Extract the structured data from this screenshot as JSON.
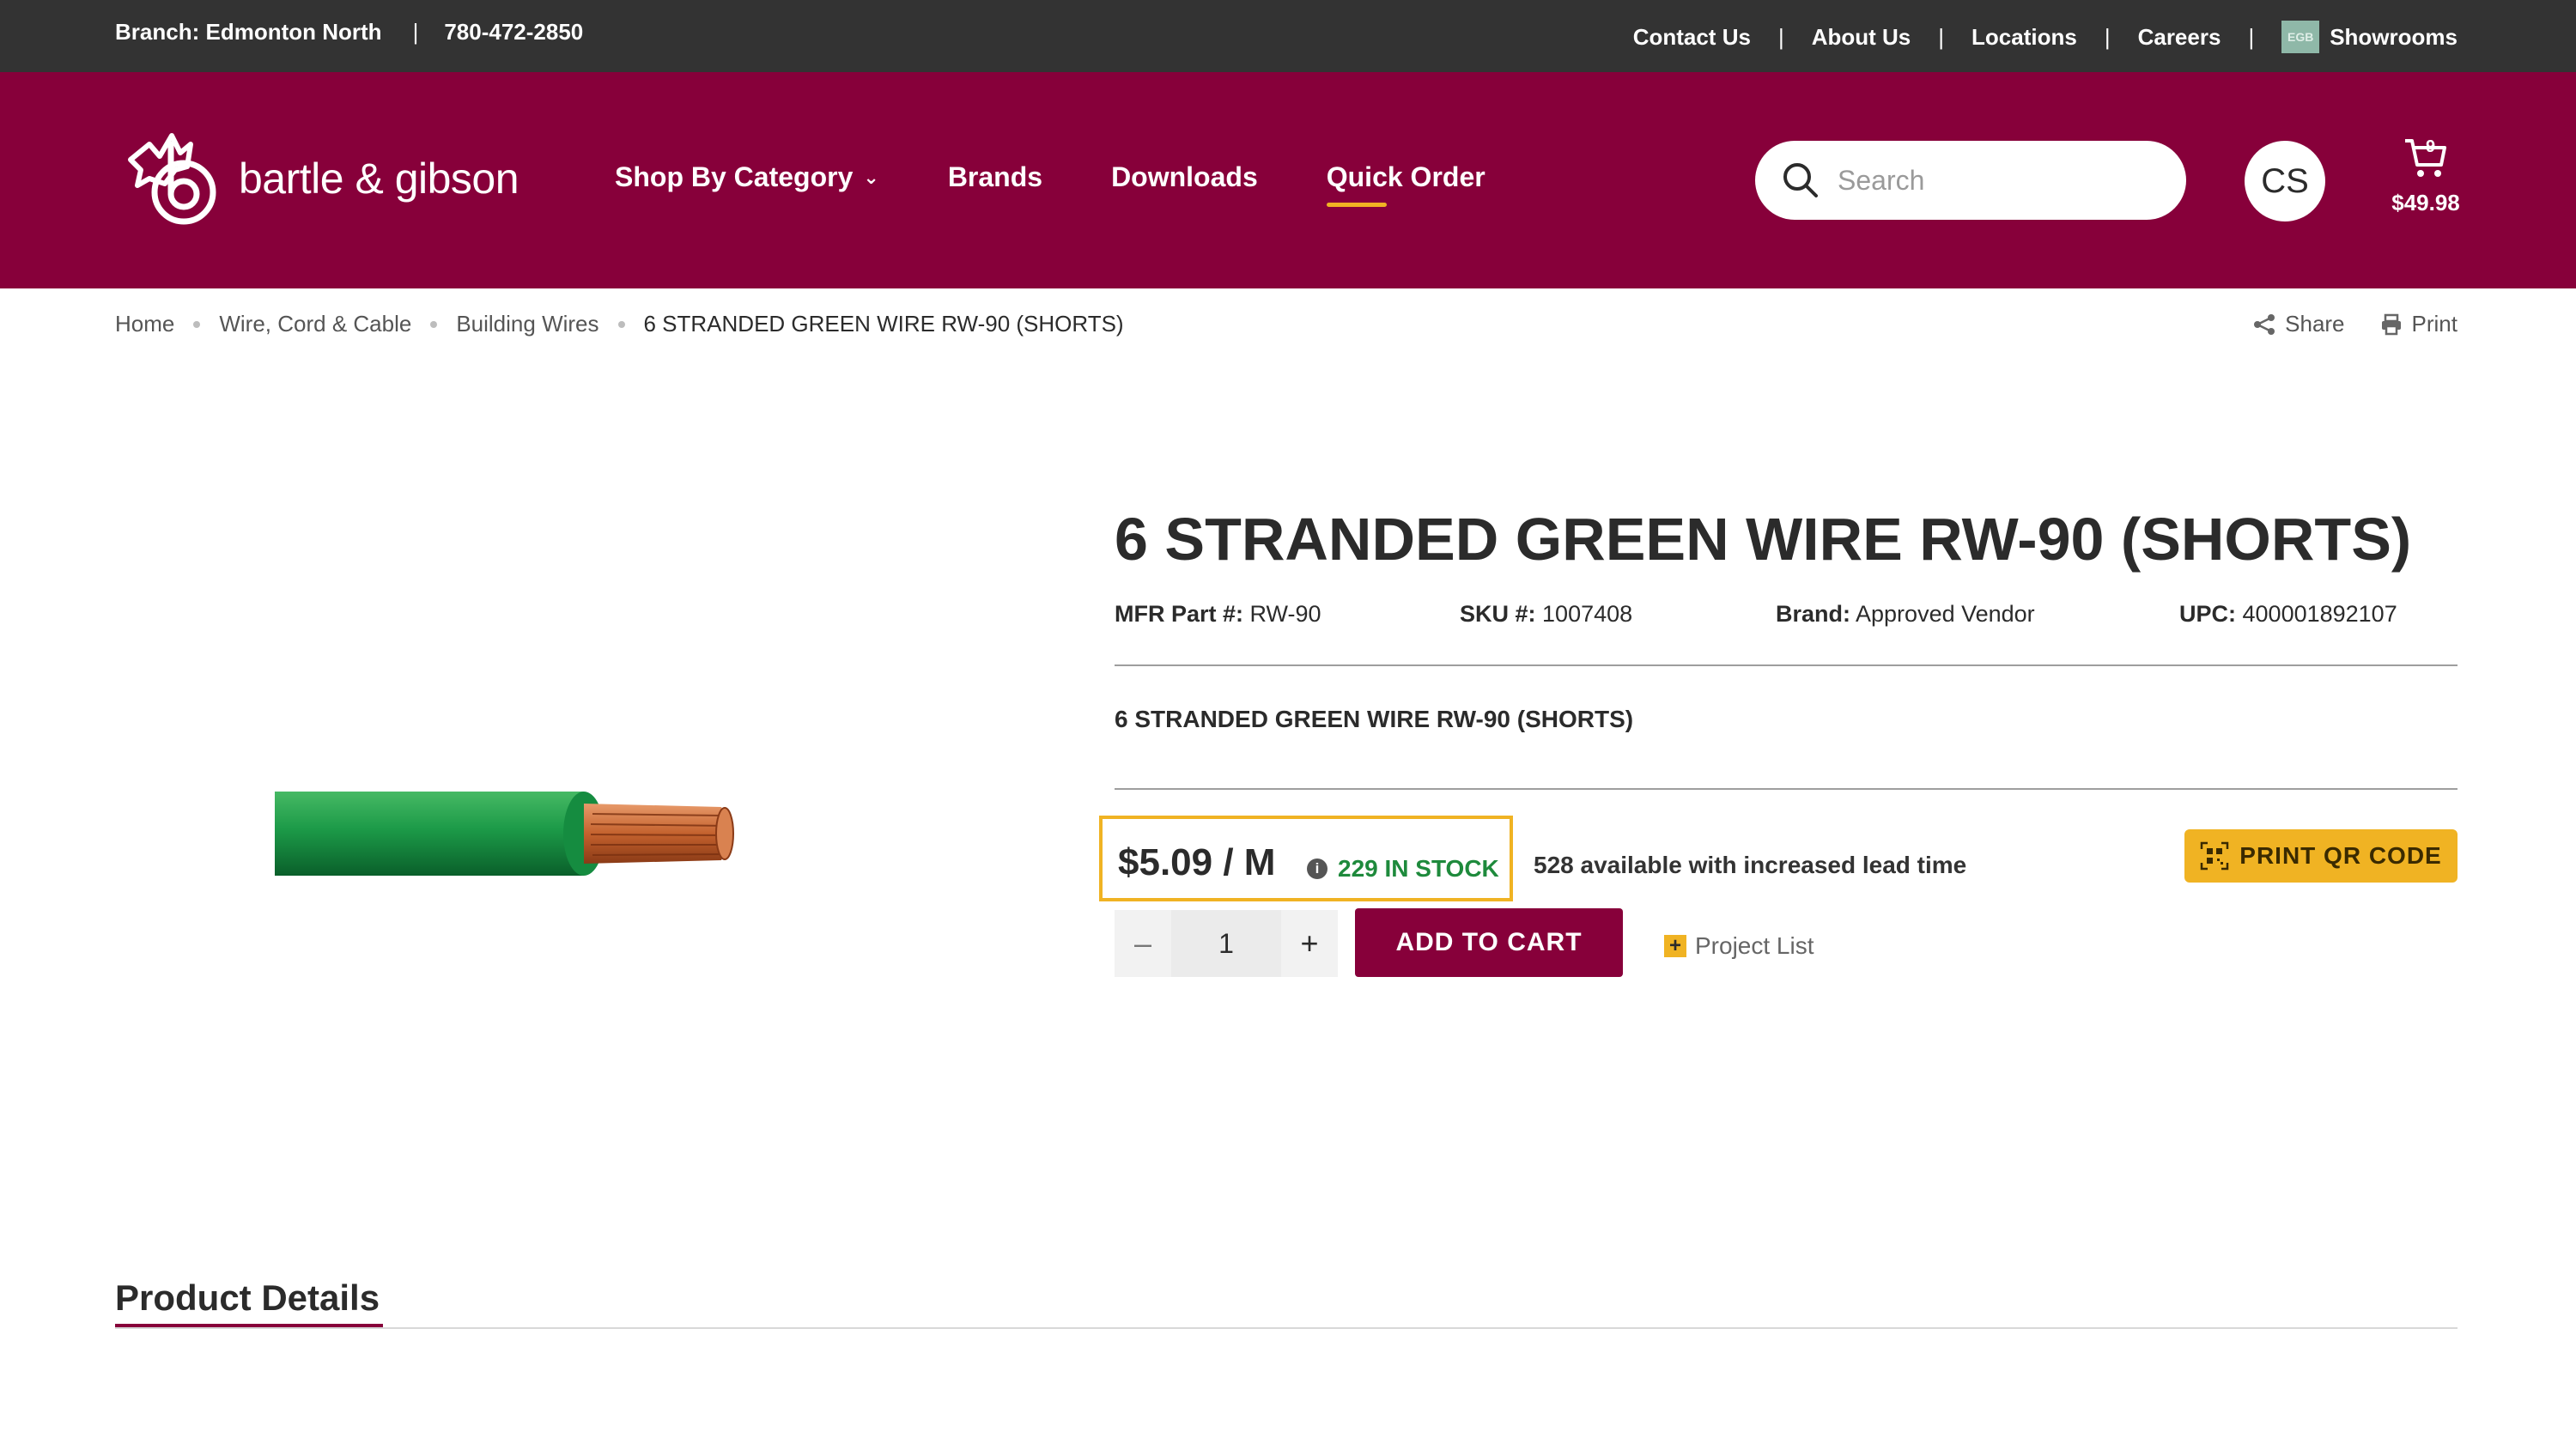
{
  "topbar": {
    "branch_label": "Branch:",
    "branch_name": "Edmonton North",
    "separator": "|",
    "phone": "780-472-2850",
    "links": [
      "Contact Us",
      "About Us",
      "Locations",
      "Careers",
      "Showrooms"
    ],
    "showroom_badge": "EGB"
  },
  "header": {
    "logo_text": "bartle & gibson",
    "nav": [
      "Shop By Category",
      "Brands",
      "Downloads",
      "Quick Order"
    ],
    "active_nav": "Quick Order",
    "search_placeholder": "Search",
    "avatar_initials": "CS",
    "cart_count": "9",
    "cart_total": "$49.98"
  },
  "breadcrumb": [
    "Home",
    "Wire, Cord & Cable",
    "Building Wires",
    "6 STRANDED GREEN WIRE RW-90 (SHORTS)"
  ],
  "actions": {
    "share": "Share",
    "print": "Print"
  },
  "product": {
    "title": "6 STRANDED GREEN WIRE RW-90 (SHORTS)",
    "mfr_label": "MFR Part #:",
    "mfr_value": "RW-90",
    "sku_label": "SKU #:",
    "sku_value": "1007408",
    "brand_label": "Brand:",
    "brand_value": "Approved Vendor",
    "upc_label": "UPC:",
    "upc_value": "400001892107",
    "description": "6 STRANDED GREEN WIRE RW-90 (SHORTS)",
    "price": "$5.09 / M",
    "stock": "229 IN STOCK",
    "lead_time": "528 available with increased lead time",
    "qr_button": "PRINT QR CODE",
    "quantity": "1",
    "add_to_cart": "ADD TO CART",
    "project_list": "Project List"
  },
  "details": {
    "tab_label": "Product Details"
  },
  "colors": {
    "brand": "#87003a",
    "accent": "#f0b323",
    "in_stock": "#1e8a3c",
    "topbar": "#333333"
  }
}
